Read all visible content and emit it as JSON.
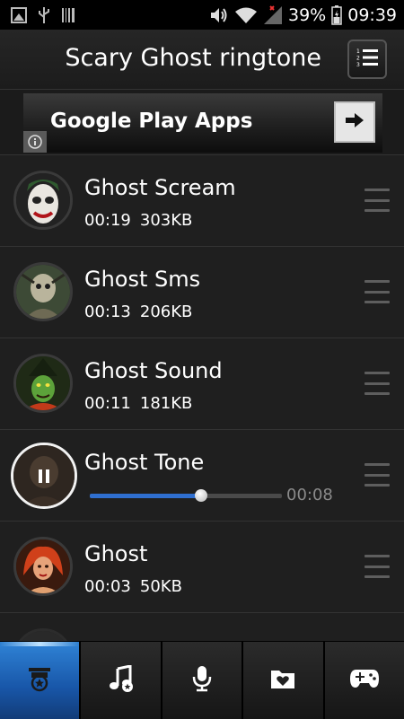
{
  "status_bar": {
    "battery_percent": "39%",
    "time": "09:39",
    "icons": [
      "screenshot-icon",
      "usb-icon",
      "barcode-icon",
      "vibrate-icon",
      "wifi-icon",
      "signal-icon",
      "battery-icon"
    ]
  },
  "app": {
    "title": "Scary Ghost ringtone",
    "list_view_icon": "numbered-list-icon"
  },
  "ad": {
    "text": "Google Play Apps",
    "arrow_icon": "arrow-right-icon",
    "info_icon": "info-icon"
  },
  "ringtones": [
    {
      "name": "Ghost Scream",
      "duration": "00:19",
      "size": "303KB",
      "thumb": "joker"
    },
    {
      "name": "Ghost Sms",
      "duration": "00:13",
      "size": "206KB",
      "thumb": "zombie"
    },
    {
      "name": "Ghost Sound",
      "duration": "00:11",
      "size": "181KB",
      "thumb": "witch"
    },
    {
      "name": "Ghost Tone",
      "playing": true,
      "progress": 0.58,
      "elapsed": "00:08",
      "thumb": "dark"
    },
    {
      "name": "Ghost",
      "duration": "00:03",
      "size": "50KB",
      "thumb": "redhead"
    }
  ],
  "bottom_nav": {
    "tabs": [
      {
        "icon": "ringtone-badge-icon",
        "active": true
      },
      {
        "icon": "music-notes-icon",
        "active": false
      },
      {
        "icon": "microphone-icon",
        "active": false
      },
      {
        "icon": "favorite-folder-icon",
        "active": false
      },
      {
        "icon": "gamepad-icon",
        "active": false
      }
    ]
  },
  "colors": {
    "accent": "#2f6fd0",
    "background": "#1b1b1b"
  }
}
